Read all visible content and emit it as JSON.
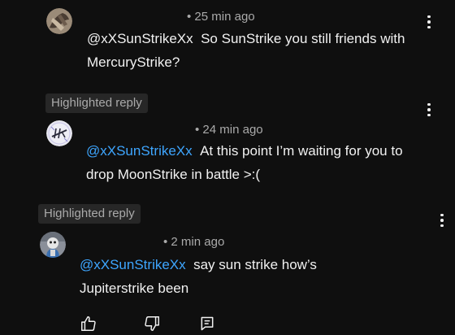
{
  "comments": [
    {
      "timestamp": "• 25 min ago",
      "mention": "@xXSunStrikeXx",
      "text": "So SunStrike you still friends with MercuryStrike?"
    },
    {
      "highlight_badge": "Highlighted reply",
      "timestamp": "• 24 min ago",
      "mention": "@xXSunStrikeXx",
      "text": "At this point I’m waiting for you to drop MoonStrike in battle >:("
    },
    {
      "highlight_badge": "Highlighted reply",
      "timestamp": "• 2 min ago",
      "mention": "@xXSunStrikeXx",
      "text": "say sun strike how’s Jupiterstrike been"
    }
  ],
  "actions": {
    "like_icon": "thumbs-up-icon",
    "dislike_icon": "thumbs-down-icon",
    "reply_icon": "reply-icon"
  },
  "colors": {
    "background": "#0f0f0f",
    "text": "#f1f1f1",
    "secondary_text": "#aaaaaa",
    "mention_link": "#3ea6ff",
    "badge_background": "#272727"
  }
}
